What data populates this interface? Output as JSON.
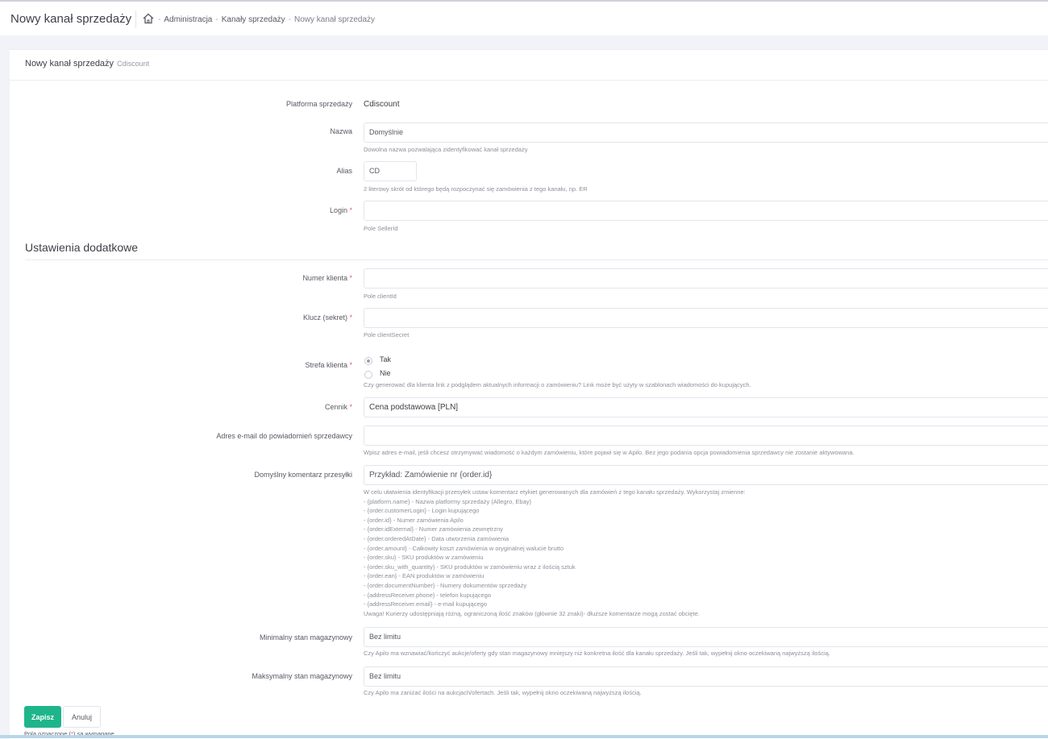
{
  "header": {
    "title": "Nowy kanał sprzedaży",
    "breadcrumbs": [
      "Administracja",
      "Kanały sprzedaży",
      "Nowy kanał sprzedaży"
    ]
  },
  "card": {
    "title": "Nowy kanał sprzedaży",
    "subtitle": "Cdiscount"
  },
  "form": {
    "platform": {
      "label": "Platforma sprzedaży",
      "value": "Cdiscount"
    },
    "name": {
      "label": "Nazwa",
      "value": "Domyślnie",
      "hint": "Dowolna nazwa pozwalająca zidentyfikować kanał sprzedaży"
    },
    "alias": {
      "label": "Alias",
      "value": "CD",
      "hint": "2 literowy skrót od którego będą rozpoczynać się zamówienia z tego kanału, np. ER"
    },
    "login": {
      "label": "Login",
      "required": "*",
      "value": "",
      "hint": "Pole SellerId"
    }
  },
  "extra": {
    "section_title": "Ustawienia dodatkowe",
    "client_number": {
      "label": "Numer klienta",
      "required": "*",
      "value": "",
      "hint": "Pole clientId"
    },
    "secret_key": {
      "label": "Klucz (sekret)",
      "required": "*",
      "value": "",
      "hint": "Pole clientSecret"
    },
    "client_zone": {
      "label": "Strefa klienta",
      "required": "*",
      "options": [
        "Tak",
        "Nie"
      ],
      "selected": "Tak",
      "hint": "Czy generować dla klienta link z podglądem aktualnych informacji o zamówieniu? Link może być użyty w szablonach wiadomości do kupujących."
    },
    "pricelist": {
      "label": "Cennik",
      "required": "*",
      "value": "Cena podstawowa [PLN]"
    },
    "email": {
      "label": "Adres e-mail do powiadomień sprzedawcy",
      "value": "",
      "hint": "Wpisz adres e-mail, jeśli chcesz otrzymywać wiadomość o każdym zamówieniu, które pojawi się w Apilo. Bez jego podania opcja powiadomienia sprzedawcy nie zostanie aktywowana."
    },
    "comment": {
      "label": "Domyślny komentarz przesyłki",
      "placeholder": "Przykład: Zamówienie nr {order.id}",
      "hint_lines": [
        "W celu ułatwienia identyfikacji przesyłek ustaw komentarz etykiet generowanych dla zamówień z tego kanału sprzedaży. Wykorzystaj zmienne:",
        "- {platform.name} - Nazwa platformy sprzedaży (Allegro, Ebay)",
        "- {order.customerLogin} - Login kupującego",
        "- {order.id} - Numer zamówienia Apilo",
        "- {order.idExternal} - Numer zamówienia zewnętrzny",
        "- {order.orderedAtDate} - Data utworzenia zamówienia",
        "- {order.amount} - Całkowity koszt zamówienia w oryginalnej walucie brutto",
        "- {order.sku} - SKU produktów w zamówieniu",
        "- {order.sku_with_quantity} - SKU produktów w zamówieniu wraz z ilością sztuk",
        "- {order.ean} - EAN produktów w zamówieniu",
        "- {order.documentNumber} - Numery dokumentów sprzedaży",
        "- {addressReceiver.phone} - telefon kupującego",
        "- {addressReceiver.email} - e-mail kupującego",
        "Uwaga! Kurierzy udostępniają różną, ograniczoną ilość znaków (głównie 32 znaki)- dłuższe komentarze mogą zostać obcięte."
      ]
    },
    "min_stock": {
      "label": "Minimalny stan magazynowy",
      "value": "Bez limitu",
      "hint": "Czy Apilo ma wznawiać/kończyć aukcje/oferty gdy stan magazynowy mniejszy niż konkretna ilość dla kanału sprzedaży. Jeśli tak, wypełnij okno oczekiwaną najwyższą ilością."
    },
    "max_stock": {
      "label": "Maksymalny stan magazynowy",
      "value": "Bez limitu",
      "hint": "Czy Apilo ma zaniżać ilości na aukcjach/ofertach. Jeśli tak, wypełnij okno oczekiwaną najwyższą ilością."
    }
  },
  "actions": {
    "save_label": "Zapisz",
    "cancel_label": "Anuluj",
    "required_note_before": "Pola oznaczone (",
    "required_note_star": "*",
    "required_note_after": ") są wymagane"
  },
  "colors": {
    "accent": "#1fb58a",
    "required": "#f4516c",
    "background": "#f2f3f8"
  },
  "icons": {
    "home": "home-icon"
  }
}
